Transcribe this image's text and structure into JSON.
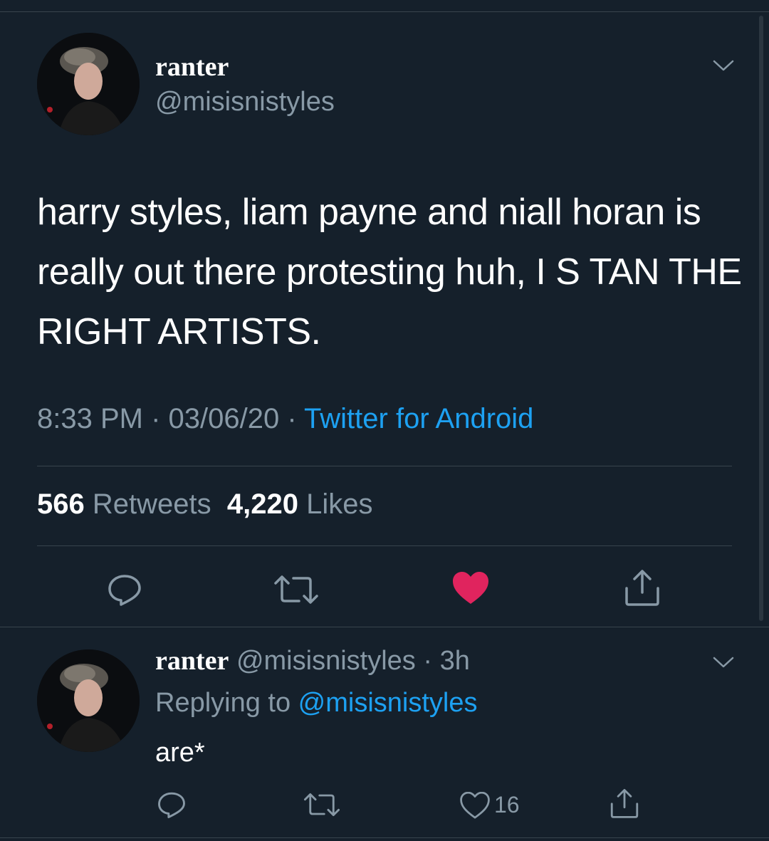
{
  "tweet": {
    "display_name": "ranter",
    "handle": "@misisnistyles",
    "text": "harry styles, liam payne and niall horan is really out there protesting huh, I S TAN THE RIGHT ARTISTS.",
    "time": "8:33 PM",
    "sep1": " · ",
    "date": "03/06/20",
    "sep2": " · ",
    "source": "Twitter for Android",
    "retweets_count": "566",
    "retweets_label": "Retweets",
    "likes_count": "4,220",
    "likes_label": "Likes"
  },
  "reply": {
    "display_name": "ranter",
    "handle": "@misisnistyles",
    "sep": " · ",
    "age": "3h",
    "replying_prefix": "Replying to ",
    "replying_to": "@misisnistyles",
    "text": "are*",
    "like_count": "16"
  },
  "icons": {
    "chevron": "chevron-down-icon",
    "reply": "reply-icon",
    "retweet": "retweet-icon",
    "like_filled": "heart-filled-icon",
    "like_outline": "heart-outline-icon",
    "share": "share-icon"
  },
  "colors": {
    "background": "#15202b",
    "muted": "#8899a6",
    "link": "#1da1f2",
    "like": "#e0245e",
    "divider": "#38444d"
  }
}
